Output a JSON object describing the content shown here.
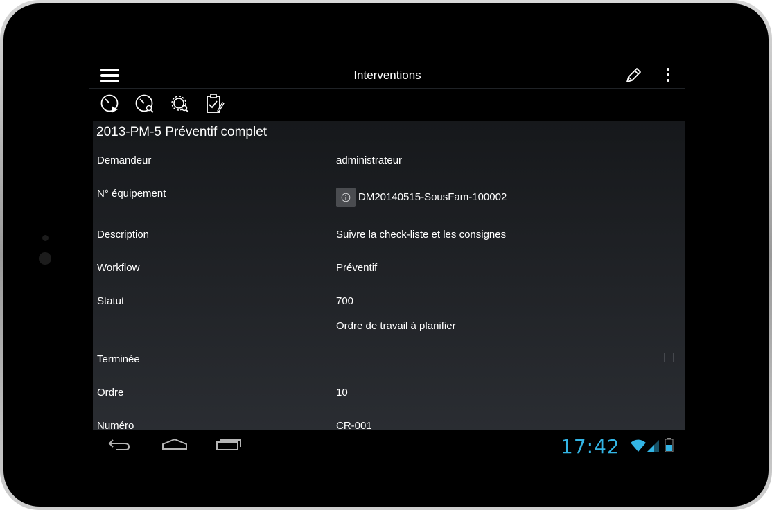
{
  "app": {
    "title": "Interventions"
  },
  "toolbar": {
    "icons": [
      "clock-play-icon",
      "clock-search-icon",
      "gear-search-icon",
      "clipboard-check-icon"
    ]
  },
  "record": {
    "title": "2013-PM-5 Préventif complet",
    "fields": {
      "demandeur": {
        "label": "Demandeur",
        "value": "administrateur"
      },
      "equipement": {
        "label": "N° équipement",
        "value": "DM20140515-SousFam-100002"
      },
      "description": {
        "label": "Description",
        "value": "Suivre la check-liste et les consignes"
      },
      "workflow": {
        "label": "Workflow",
        "value": "Préventif"
      },
      "statut": {
        "label": "Statut",
        "value": "700",
        "detail": "Ordre de travail à planifier"
      },
      "terminee": {
        "label": "Terminée",
        "checked": false
      },
      "ordre": {
        "label": "Ordre",
        "value": "10"
      },
      "numero": {
        "label": "Numéro",
        "value": "CR-001"
      }
    }
  },
  "statusbar": {
    "time": "17:42"
  },
  "colors": {
    "accent": "#33b5e5",
    "screen_bg": "#000000",
    "text": "#ffffff"
  }
}
